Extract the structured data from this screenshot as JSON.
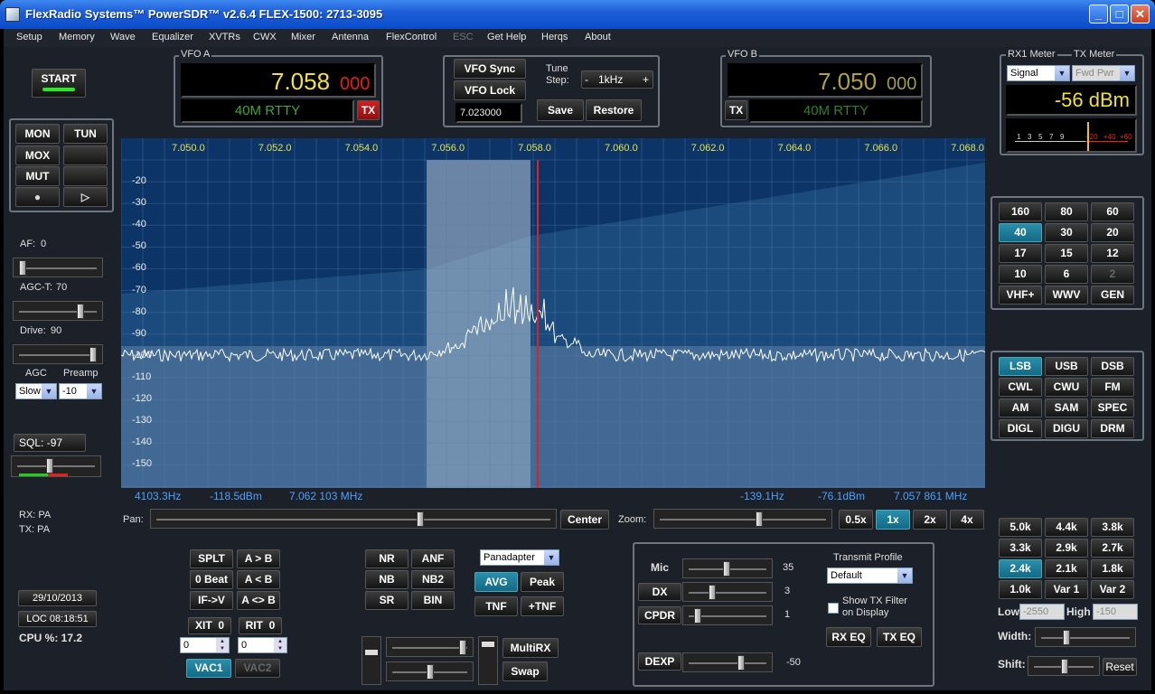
{
  "window": {
    "title": "FlexRadio Systems™  PowerSDR™  v2.6.4   FLEX-1500:  2713-3095",
    "min": "_",
    "max": "□",
    "close": "✕"
  },
  "menu": [
    "Setup",
    "Memory",
    "Wave",
    "Equalizer",
    "XVTRs",
    "CWX",
    "Mixer",
    "Antenna",
    "FlexControl",
    "ESC",
    "Get Help",
    "Herqs",
    "About"
  ],
  "start": "START",
  "mon": {
    "mon": "MON",
    "tun": "TUN",
    "mox": "MOX",
    "mut": "MUT",
    "rec": "●",
    "play": "▷"
  },
  "af": {
    "label": "AF:",
    "value": "0"
  },
  "agct": {
    "label": "AGC-T:",
    "value": "70"
  },
  "drive": {
    "label": "Drive:",
    "value": "90"
  },
  "agc": {
    "label": "AGC",
    "value": "Slow"
  },
  "preamp": {
    "label": "Preamp",
    "value": "-10"
  },
  "sql": {
    "label": "SQL:",
    "value": "-97"
  },
  "rx": "RX: PA",
  "tx": "TX: PA",
  "date": "29/10/2013",
  "time": "LOC 08:18:51",
  "cpu": "CPU %: 17.2",
  "vfoa": {
    "title": "VFO A",
    "freq": "7.058",
    "sub": "000",
    "mode": "40M RTTY",
    "tx": "TX"
  },
  "vfob": {
    "title": "VFO B",
    "freq": "7.050",
    "sub": "000",
    "mode": "40M RTTY",
    "tx": "TX"
  },
  "vfoctl": {
    "sync": "VFO Sync",
    "lock": "VFO Lock",
    "tune": "Tune Step:",
    "minus": "-",
    "step": "1kHz",
    "plus": "+",
    "mem": "7.023000",
    "save": "Save",
    "restore": "Restore"
  },
  "meter": {
    "rx_title": "RX1 Meter",
    "tx_title": "TX Meter",
    "rx_sel": "Signal",
    "tx_sel": "Fwd Pwr",
    "value": "-56 dBm",
    "scale": [
      "1",
      "3",
      "5",
      "7",
      "9",
      "+20",
      "+40",
      "+60"
    ]
  },
  "bands": [
    "160",
    "80",
    "60",
    "40",
    "30",
    "20",
    "17",
    "15",
    "12",
    "10",
    "6",
    "2",
    "VHF+",
    "WWV",
    "GEN"
  ],
  "modes": [
    "LSB",
    "USB",
    "DSB",
    "CWL",
    "CWU",
    "FM",
    "AM",
    "SAM",
    "SPEC",
    "DIGL",
    "DIGU",
    "DRM"
  ],
  "filters": [
    "5.0k",
    "4.4k",
    "3.8k",
    "3.3k",
    "2.9k",
    "2.7k",
    "2.4k",
    "2.1k",
    "1.8k",
    "1.0k",
    "Var 1",
    "Var 2"
  ],
  "filterctl": {
    "low": "Low",
    "low_val": "-2550",
    "high": "High",
    "high_val": "-150",
    "width": "Width:",
    "shift": "Shift:",
    "reset": "Reset"
  },
  "xaxis": [
    "7.050.0",
    "7.052.0",
    "7.054.0",
    "7.056.0",
    "7.058.0",
    "7.060.0",
    "7.062.0",
    "7.064.0",
    "7.066.0",
    "7.068.0"
  ],
  "yaxis": [
    "-20",
    "-30",
    "-40",
    "-50",
    "-60",
    "-70",
    "-80",
    "-90",
    "-100",
    "-110",
    "-120",
    "-130",
    "-140",
    "-150"
  ],
  "readout": {
    "l1": "4103.3Hz",
    "l2": "-118.5dBm",
    "l3": "7.062 103 MHz",
    "r1": "-139.1Hz",
    "r2": "-76.1dBm",
    "r3": "7.057 861 MHz"
  },
  "pan": {
    "label": "Pan:",
    "center": "Center",
    "zoom": "Zoom:",
    "z": [
      "0.5x",
      "1x",
      "2x",
      "4x"
    ]
  },
  "rit": {
    "splt": "SPLT",
    "atob": "A > B",
    "zerobeat": "0 Beat",
    "btoa": "A < B",
    "ifv": "IF->V",
    "swap": "A <> B",
    "xit": "XIT",
    "xit_val": "0",
    "rit": "RIT",
    "rit_val": "0",
    "xit_spin": "0",
    "rit_spin": "0",
    "vac1": "VAC1",
    "vac2": "VAC2"
  },
  "dsp": {
    "nr": "NR",
    "anf": "ANF",
    "nb": "NB",
    "nb2": "NB2",
    "sr": "SR",
    "bin": "BIN",
    "display": "Panadapter",
    "avg": "AVG",
    "peak": "Peak",
    "tnf": "TNF",
    "ptnf": "+TNF"
  },
  "multirx": {
    "multi": "MultiRX",
    "swap": "Swap"
  },
  "txpanel": {
    "mic": "Mic",
    "mic_val": "35",
    "dx": "DX",
    "dx_val": "3",
    "cpdr": "CPDR",
    "cpdr_val": "1",
    "dexp": "DEXP",
    "dexp_val": "-50",
    "profile_title": "Transmit Profile",
    "profile": "Default",
    "show_filter": "Show TX Filter on Display",
    "rxeq": "RX EQ",
    "txeq": "TX EQ"
  }
}
